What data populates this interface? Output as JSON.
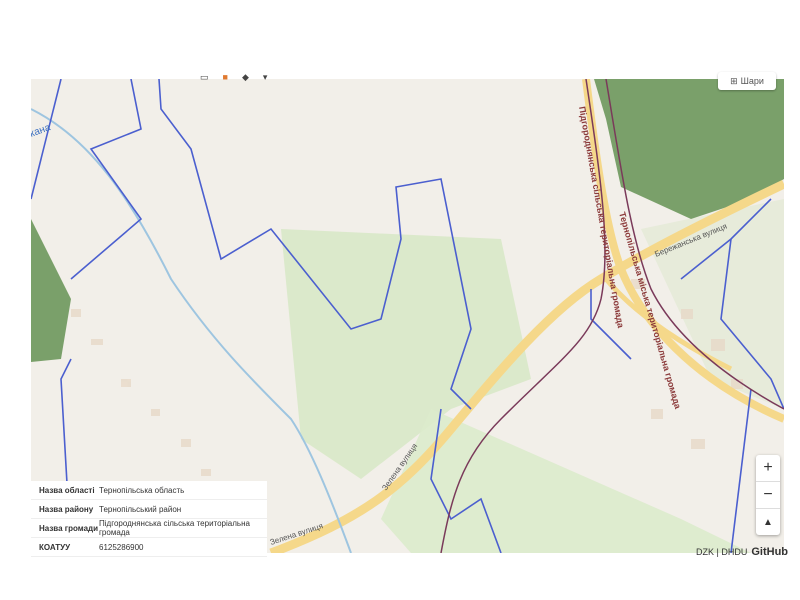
{
  "map": {
    "labels": {
      "kanal": "кана",
      "pidgorodnianska": "Підгороднянська сільська територіальна громада",
      "ternopilska": "Тернопільська міська територіальна громада",
      "berezhanska": "Бережанська вулиця",
      "zelena1": "Зелена вулиця",
      "zelena2": "Зелена вулиця"
    },
    "colors": {
      "background": "#f2efe9",
      "forest": "#7aa06a",
      "field": "#d8e8c8",
      "road": "#f5d88a",
      "boundary": "#4b5fcf",
      "hromada_border": "#8b3a3a"
    }
  },
  "layer_button": {
    "label": "Шари"
  },
  "zoom": {
    "in": "+",
    "out": "−",
    "north": "▲"
  },
  "info_panel": {
    "rows": [
      {
        "key": "Назва області",
        "value": "Тернопільська область"
      },
      {
        "key": "Назва району",
        "value": "Тернопільський район"
      },
      {
        "key": "Назва громади",
        "value": "Підгороднянська сільська територіальна громада"
      },
      {
        "key": "КОАТУУ",
        "value": "6125286900"
      }
    ]
  },
  "attribution": {
    "text": "DZK | DHDU",
    "github": "GitHub"
  }
}
